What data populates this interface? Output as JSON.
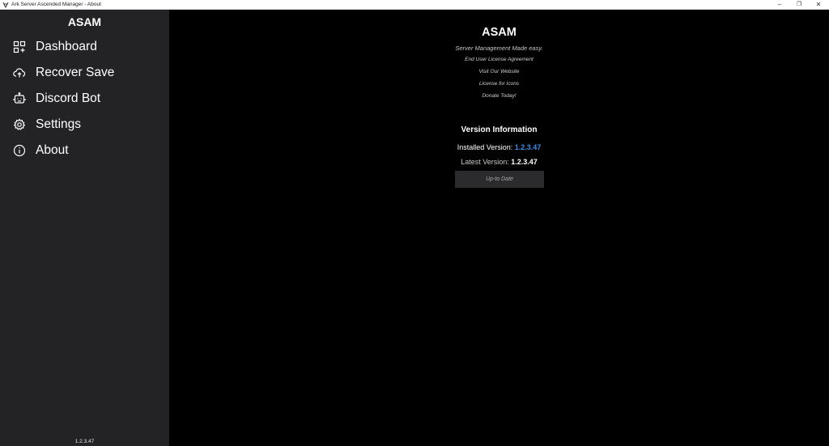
{
  "window": {
    "title": "Ark Server Ascended Manager - About",
    "app_icon": "asam-app-icon",
    "controls": {
      "minimize": "–",
      "maximize": "❐",
      "close": "✕"
    }
  },
  "sidebar": {
    "title": "ASAM",
    "items": [
      {
        "label": "Dashboard",
        "icon": "dashboard-icon"
      },
      {
        "label": "Recover Save",
        "icon": "cloud-upload-icon"
      },
      {
        "label": "Discord Bot",
        "icon": "bot-icon"
      },
      {
        "label": "Settings",
        "icon": "gear-icon"
      },
      {
        "label": "About",
        "icon": "info-icon"
      }
    ],
    "version": "1.2.3.47"
  },
  "main": {
    "app_name": "ASAM",
    "tagline": "Server Management Made easy.",
    "links": [
      "End User License Agreement",
      "Visit Our Website",
      "License for Icons",
      "Donate Today!"
    ],
    "version_info": {
      "heading": "Version Information",
      "installed_label": "Installed Version:",
      "installed_value": "1.2.3.47",
      "latest_label": "Latest Version:",
      "latest_value": "1.2.3.47",
      "status_button": "Up-to Date"
    }
  },
  "colors": {
    "sidebar_bg": "#232326",
    "main_bg": "#000000",
    "accent_blue": "#3a8ee6",
    "button_bg": "#2b2b2e"
  }
}
